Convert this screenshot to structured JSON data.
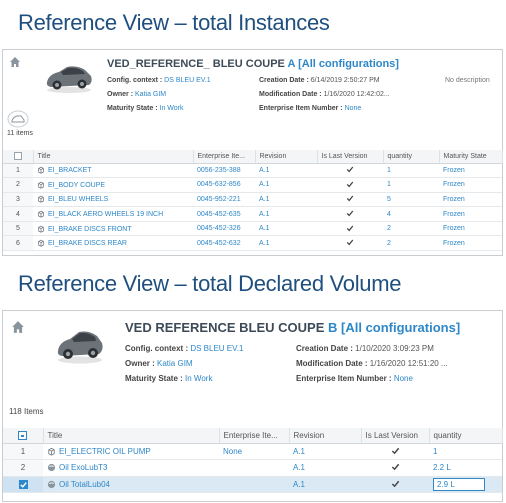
{
  "view_a": {
    "section_title": "Reference View – total Instances",
    "object": {
      "name": "VED_REFERENCE_ BLEU COUPE",
      "version": "A",
      "config": "[All configurations]",
      "config_context_label": "Config. context :",
      "config_context_value": "DS BLEU EV.1",
      "owner_label": "Owner :",
      "owner_value": "Katia GIM",
      "maturity_label": "Maturity State :",
      "maturity_value": "In Work",
      "creation_label": "Creation Date :",
      "creation_value": "6/14/2019 2:50:27 PM",
      "modification_label": "Modification Date :",
      "modification_value": "1/16/2020 12:42:02...",
      "eid_label": "Enterprise Item Number :",
      "eid_value": "None",
      "description": "No description"
    },
    "items_count": "11 items",
    "columns": [
      "Title",
      "Enterprise Ite...",
      "Revision",
      "Is Last Version",
      "quantity",
      "Maturity State"
    ],
    "rows": [
      {
        "n": "1",
        "title": "EI_BRACKET",
        "eid": "0056-235-388",
        "rev": "A.1",
        "qty": "1",
        "state": "Frozen"
      },
      {
        "n": "2",
        "title": "EI_BODY COUPE",
        "eid": "0045-632-856",
        "rev": "A.1",
        "qty": "1",
        "state": "Frozen"
      },
      {
        "n": "3",
        "title": "EI_BLEU WHEELS",
        "eid": "0045-952-221",
        "rev": "A.1",
        "qty": "5",
        "state": "Frozen"
      },
      {
        "n": "4",
        "title": "EI_BLACK AERO WHEELS 19 INCH",
        "eid": "0045-452-635",
        "rev": "A.1",
        "qty": "4",
        "state": "Frozen"
      },
      {
        "n": "5",
        "title": "EI_BRAKE DISCS FRONT",
        "eid": "0045-452-326",
        "rev": "A.1",
        "qty": "2",
        "state": "Frozen"
      },
      {
        "n": "6",
        "title": "EI_BRAKE DISCS REAR",
        "eid": "0045-452-632",
        "rev": "A.1",
        "qty": "2",
        "state": "Frozen"
      }
    ]
  },
  "view_b": {
    "section_title": "Reference View – total Declared Volume",
    "object": {
      "name": "VED REFERENCE BLEU COUPE",
      "version": "B",
      "config": "[All configurations]",
      "config_context_label": "Config. context :",
      "config_context_value": "DS BLEU EV.1",
      "owner_label": "Owner :",
      "owner_value": "Katia GIM",
      "maturity_label": "Maturity State :",
      "maturity_value": "In Work",
      "creation_label": "Creation Date :",
      "creation_value": "1/10/2020 3:09:23 PM",
      "modification_label": "Modification Date :",
      "modification_value": "1/16/2020 12:51:20 ...",
      "eid_label": "Enterprise Item Number :",
      "eid_value": "None"
    },
    "items_count": "118 Items",
    "columns": [
      "Title",
      "Enterprise Ite...",
      "Revision",
      "Is Last Version",
      "quantity"
    ],
    "rows": [
      {
        "n": "1",
        "title": "EI_ELECTRIC OIL PUMP",
        "eid": "None",
        "rev": "A.1",
        "qty": "1"
      },
      {
        "n": "2",
        "title": "Oil ExoLubT3",
        "eid": "",
        "rev": "A.1",
        "qty": "2.2 L"
      },
      {
        "n": "",
        "title": "Oil TotalLub04",
        "eid": "",
        "rev": "A.1",
        "qty": "2.9 L"
      }
    ]
  }
}
